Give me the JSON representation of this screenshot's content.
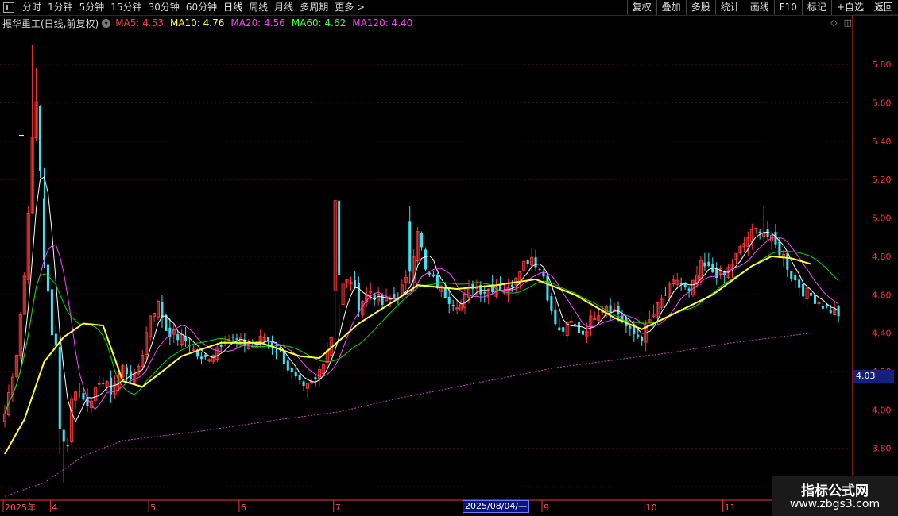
{
  "toolbar": {
    "left": [
      {
        "label": "分时"
      },
      {
        "label": "1分钟"
      },
      {
        "label": "5分钟"
      },
      {
        "label": "15分钟"
      },
      {
        "label": "30分钟"
      },
      {
        "label": "60分钟"
      },
      {
        "label": "日线",
        "active": true
      },
      {
        "label": "周线"
      },
      {
        "label": "月线"
      },
      {
        "label": "多周期"
      },
      {
        "label": "更多 >"
      }
    ],
    "right": [
      {
        "label": "复权"
      },
      {
        "label": "叠加"
      },
      {
        "label": "多股"
      },
      {
        "label": "统计"
      },
      {
        "label": "画线"
      },
      {
        "label": "F10"
      },
      {
        "label": "标记"
      },
      {
        "label": "+自选"
      },
      {
        "label": "返回"
      }
    ]
  },
  "stock": {
    "title": "振华重工(日线,前复权)",
    "ma": [
      {
        "name": "MA5: 4.53",
        "color": "#ff3b3b"
      },
      {
        "name": "MA10: 4.76",
        "color": "#ffff40"
      },
      {
        "name": "MA20: 4.56",
        "color": "#ff40ff"
      },
      {
        "name": "MA60: 4.62",
        "color": "#40ff40"
      },
      {
        "name": "MA120: 4.40",
        "color": "#ff40ff"
      }
    ]
  },
  "info_icons": [
    "◇",
    "◫"
  ],
  "current_price": "4.03",
  "date_tag": "2025/08/04/—",
  "watermark": {
    "title": "指标公式网",
    "url": "www.zbgs3.com"
  },
  "colors": {
    "up": "#ff3a3a",
    "down": "#40e0f0",
    "grid": "#3a1010",
    "axis": "#ff3333",
    "ma_white": "#ffffff",
    "ma_yellow": "#ffff33",
    "ma_green": "#00dd00",
    "ma_magenta": "#ff44ff",
    "ma_dotted": "#cc44cc"
  },
  "chart_data": {
    "type": "candlestick",
    "y_ticks": [
      "5.80",
      "5.60",
      "5.40",
      "5.20",
      "5.00",
      "4.80",
      "4.60",
      "4.40",
      "4.20",
      "4.00",
      "3.80",
      "3.60"
    ],
    "y_tick_values": [
      5.8,
      5.6,
      5.4,
      5.2,
      5.0,
      4.8,
      4.6,
      4.4,
      4.2,
      4.0,
      3.8,
      3.6
    ],
    "ylim": [
      3.53,
      5.97
    ],
    "x_labels": [
      {
        "label": "2025年",
        "index": 0
      },
      {
        "label": "4",
        "index": 12
      },
      {
        "label": "5",
        "index": 37
      },
      {
        "label": "6",
        "index": 60
      },
      {
        "label": "7",
        "index": 84
      },
      {
        "label": "9",
        "index": 137
      },
      {
        "label": "10",
        "index": 163
      },
      {
        "label": "11",
        "index": 183
      }
    ],
    "ma120": [
      [
        0,
        3.55
      ],
      [
        10,
        3.62
      ],
      [
        20,
        3.76
      ],
      [
        30,
        3.84
      ],
      [
        50,
        3.89
      ],
      [
        70,
        3.95
      ],
      [
        85,
        3.99
      ],
      [
        100,
        4.06
      ],
      [
        120,
        4.14
      ],
      [
        140,
        4.22
      ],
      [
        155,
        4.26
      ],
      [
        170,
        4.3
      ],
      [
        185,
        4.35
      ],
      [
        205,
        4.4
      ]
    ],
    "ma_yellow": [
      [
        0,
        3.77
      ],
      [
        5,
        3.95
      ],
      [
        10,
        4.25
      ],
      [
        15,
        4.38
      ],
      [
        20,
        4.45
      ],
      [
        25,
        4.44
      ],
      [
        30,
        4.15
      ],
      [
        35,
        4.12
      ],
      [
        45,
        4.28
      ],
      [
        55,
        4.35
      ],
      [
        65,
        4.35
      ],
      [
        75,
        4.28
      ],
      [
        80,
        4.27
      ],
      [
        90,
        4.45
      ],
      [
        100,
        4.58
      ],
      [
        105,
        4.65
      ],
      [
        115,
        4.63
      ],
      [
        125,
        4.65
      ],
      [
        135,
        4.68
      ],
      [
        145,
        4.6
      ],
      [
        155,
        4.48
      ],
      [
        162,
        4.42
      ],
      [
        168,
        4.48
      ],
      [
        180,
        4.6
      ],
      [
        190,
        4.75
      ],
      [
        195,
        4.8
      ],
      [
        200,
        4.79
      ],
      [
        205,
        4.76
      ]
    ]
  }
}
